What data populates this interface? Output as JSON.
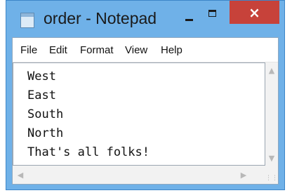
{
  "window": {
    "title": "order - Notepad",
    "minimize_glyph": "",
    "maximize_glyph": "",
    "close_glyph": "×"
  },
  "menu": [
    "File",
    "Edit",
    "Format",
    "View",
    "Help"
  ],
  "editor": {
    "lines": [
      "West",
      "East",
      "South",
      "North",
      "That's all folks!"
    ]
  },
  "scrollbars": {
    "up_icon": "chevron-up-icon",
    "down_icon": "chevron-down-icon",
    "left_icon": "chevron-left-icon",
    "right_icon": "chevron-right-icon",
    "grip_icon": "resize-grip-icon"
  },
  "colors": {
    "title_bar": "#6fb1e8",
    "close_button": "#c7423a"
  }
}
